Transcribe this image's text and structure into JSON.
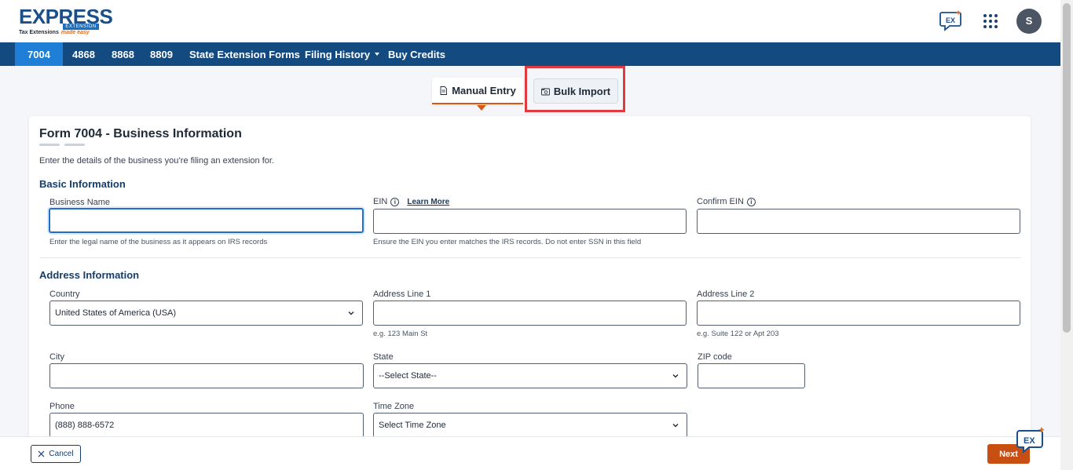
{
  "app": {
    "logo": {
      "word": "EXPRESS",
      "band": "EXTENSION",
      "sub": "Tax Extensions",
      "tagline": "made easy"
    },
    "user_initial": "S"
  },
  "nav": {
    "items": [
      {
        "label": "7004",
        "active": true
      },
      {
        "label": "4868"
      },
      {
        "label": "8868"
      },
      {
        "label": "8809"
      },
      {
        "label": "State Extension Forms"
      },
      {
        "label": "Filing History",
        "dropdown": true
      },
      {
        "label": "Buy Credits"
      }
    ]
  },
  "tabs": {
    "manual": "Manual Entry",
    "bulk": "Bulk Import"
  },
  "form": {
    "title": "Form 7004 - Business Information",
    "description": "Enter the details of the business you’re filing an extension for.",
    "basic": {
      "section_title": "Basic Information",
      "business_name": {
        "label": "Business Name",
        "value": "",
        "hint": "Enter the legal name of the business as it appears on IRS records"
      },
      "ein": {
        "label": "EIN",
        "learn_more": "Learn More",
        "value": "",
        "hint": "Ensure the EIN you enter matches the IRS records. Do not enter SSN in this field"
      },
      "confirm_ein": {
        "label": "Confirm EIN",
        "value": ""
      }
    },
    "address": {
      "section_title": "Address Information",
      "country": {
        "label": "Country",
        "value": "United States of America (USA)"
      },
      "address1": {
        "label": "Address Line 1",
        "value": "",
        "hint": "e.g. 123 Main St"
      },
      "address2": {
        "label": "Address Line 2",
        "value": "",
        "hint": "e.g. Suite 122 or Apt 203"
      },
      "city": {
        "label": "City",
        "value": ""
      },
      "state": {
        "label": "State",
        "value": "--Select State--"
      },
      "zip": {
        "label": "ZIP code",
        "value": ""
      },
      "phone": {
        "label": "Phone",
        "value": "(888) 888-6572"
      },
      "timezone": {
        "label": "Time Zone",
        "value": "Select Time Zone"
      }
    }
  },
  "footer": {
    "cancel": "Cancel",
    "next": "Next"
  },
  "colors": {
    "nav_bg": "#134a80",
    "nav_active": "#1f7fd6",
    "accent_orange": "#c94e12",
    "highlight_red": "#e0393e",
    "heading_blue": "#153d6b"
  }
}
